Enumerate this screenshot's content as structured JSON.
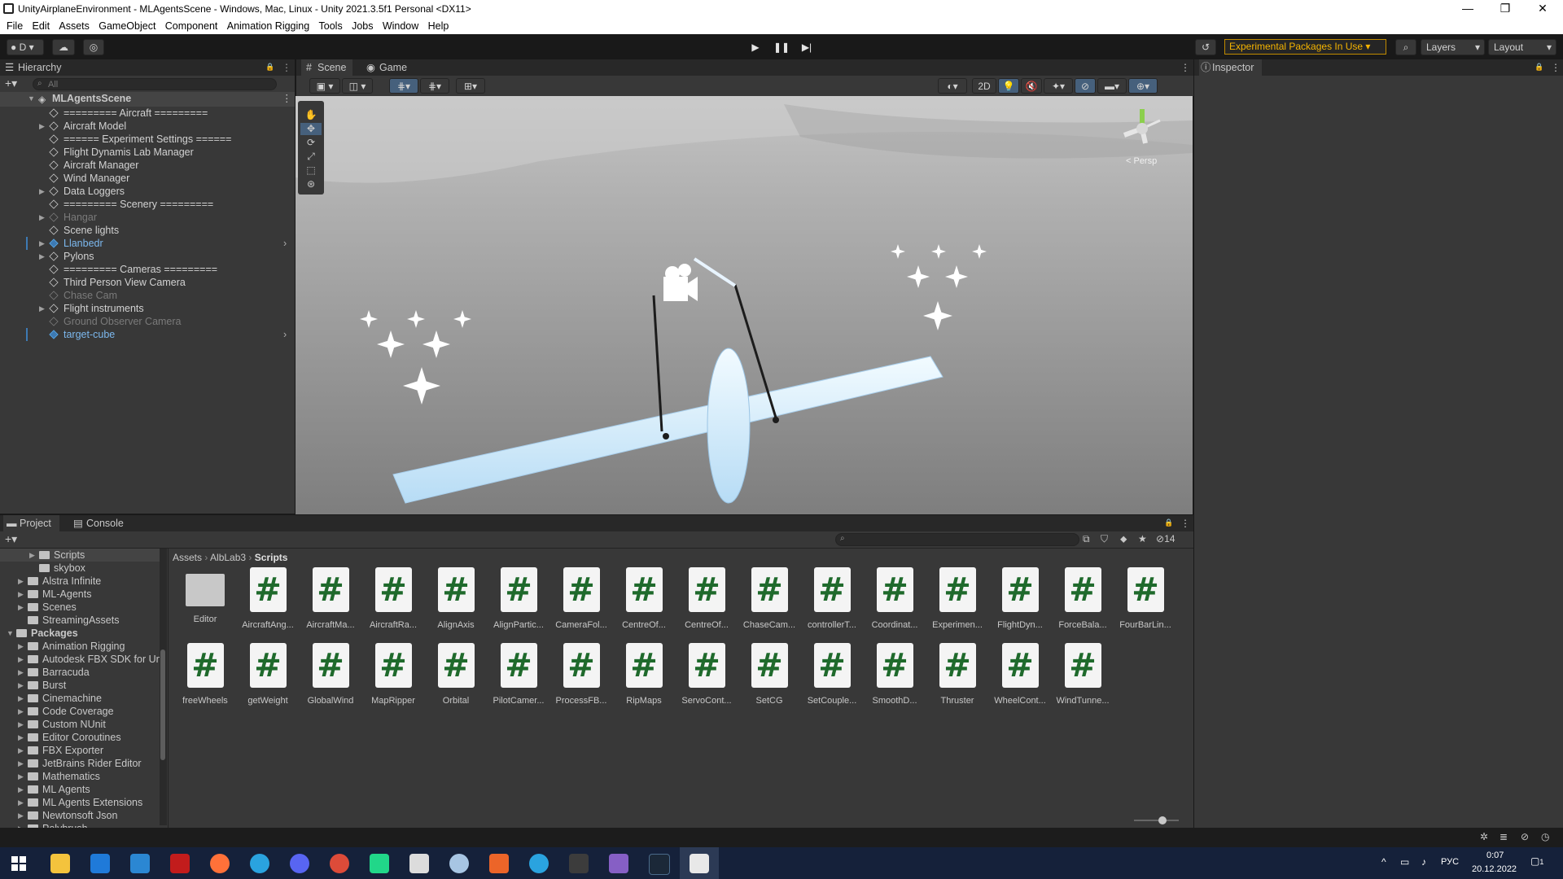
{
  "window": {
    "title": "UnityAirplaneEnvironment - MLAgentsScene - Windows, Mac, Linux - Unity 2021.3.5f1 Personal <DX11>"
  },
  "menu": [
    "File",
    "Edit",
    "Assets",
    "GameObject",
    "Component",
    "Animation Rigging",
    "Tools",
    "Jobs",
    "Window",
    "Help"
  ],
  "toolbar": {
    "account": "D",
    "experimental": "Experimental Packages In Use",
    "layers": "Layers",
    "layout": "Layout"
  },
  "hierarchy": {
    "tab": "Hierarchy",
    "search_placeholder": "All",
    "scene": "MLAgentsScene",
    "items": [
      {
        "label": "========= Aircraft =========",
        "style": "normal",
        "expand": false
      },
      {
        "label": "Aircraft Model",
        "style": "normal",
        "expand": true
      },
      {
        "label": "====== Experiment Settings ======",
        "style": "normal",
        "expand": false
      },
      {
        "label": "Flight Dynamis Lab Manager",
        "style": "normal",
        "expand": false
      },
      {
        "label": "Aircraft Manager",
        "style": "normal",
        "expand": false
      },
      {
        "label": "Wind Manager",
        "style": "normal",
        "expand": false
      },
      {
        "label": "Data Loggers",
        "style": "normal",
        "expand": true
      },
      {
        "label": "========= Scenery =========",
        "style": "normal",
        "expand": false
      },
      {
        "label": "Hangar",
        "style": "dim",
        "expand": true
      },
      {
        "label": "Scene lights",
        "style": "normal",
        "expand": false
      },
      {
        "label": "Llanbedr",
        "style": "blue",
        "expand": true
      },
      {
        "label": "Pylons",
        "style": "normal",
        "expand": true
      },
      {
        "label": "========= Cameras =========",
        "style": "normal",
        "expand": false
      },
      {
        "label": "Third Person View Camera",
        "style": "normal",
        "expand": false
      },
      {
        "label": "Chase Cam",
        "style": "dim",
        "expand": false
      },
      {
        "label": "Flight instruments",
        "style": "normal",
        "expand": true
      },
      {
        "label": "Ground Observer Camera",
        "style": "dim",
        "expand": false
      },
      {
        "label": "target-cube",
        "style": "blue",
        "expand": false
      }
    ]
  },
  "scene": {
    "tabs": [
      "Scene",
      "Game"
    ],
    "mode_2d": "2D",
    "persp": "< Persp"
  },
  "inspector": {
    "tab": "Inspector"
  },
  "project": {
    "tabs": [
      "Project",
      "Console"
    ],
    "breadcrumb": [
      "Assets",
      "AlbLab3",
      "Scripts"
    ],
    "hidden_count": "14",
    "tree": [
      {
        "label": "Scripts",
        "indent": 2,
        "expand": true
      },
      {
        "label": "skybox",
        "indent": 2,
        "expand": false
      },
      {
        "label": "Alstra Infinite",
        "indent": 1,
        "expand": true
      },
      {
        "label": "ML-Agents",
        "indent": 1,
        "expand": true
      },
      {
        "label": "Scenes",
        "indent": 1,
        "expand": true
      },
      {
        "label": "StreamingAssets",
        "indent": 1,
        "expand": false
      },
      {
        "label": "Packages",
        "indent": 0,
        "expand": true,
        "bold": true
      },
      {
        "label": "Animation Rigging",
        "indent": 1,
        "expand": true
      },
      {
        "label": "Autodesk FBX SDK for Un",
        "indent": 1,
        "expand": true
      },
      {
        "label": "Barracuda",
        "indent": 1,
        "expand": true
      },
      {
        "label": "Burst",
        "indent": 1,
        "expand": true
      },
      {
        "label": "Cinemachine",
        "indent": 1,
        "expand": true
      },
      {
        "label": "Code Coverage",
        "indent": 1,
        "expand": true
      },
      {
        "label": "Custom NUnit",
        "indent": 1,
        "expand": true
      },
      {
        "label": "Editor Coroutines",
        "indent": 1,
        "expand": true
      },
      {
        "label": "FBX Exporter",
        "indent": 1,
        "expand": true
      },
      {
        "label": "JetBrains Rider Editor",
        "indent": 1,
        "expand": true
      },
      {
        "label": "Mathematics",
        "indent": 1,
        "expand": true
      },
      {
        "label": "ML Agents",
        "indent": 1,
        "expand": true
      },
      {
        "label": "ML Agents Extensions",
        "indent": 1,
        "expand": true
      },
      {
        "label": "Newtonsoft Json",
        "indent": 1,
        "expand": true
      },
      {
        "label": "Polybrush",
        "indent": 1,
        "expand": true
      }
    ],
    "assets_row1": [
      "Editor",
      "AircraftAng...",
      "AircraftMa...",
      "AircraftRa...",
      "AlignAxis",
      "AlignPartic...",
      "CameraFol...",
      "CentreOf...",
      "CentreOf...",
      "ChaseCam...",
      "controllerT...",
      "Coordinat...",
      "Experimen...",
      "FlightDyn...",
      "ForceBala...",
      "FourBarLin..."
    ],
    "assets_row2": [
      "freeWheels",
      "getWeight",
      "GlobalWind",
      "MapRipper",
      "Orbital",
      "PilotCamer...",
      "ProcessFB...",
      "RipMaps",
      "ServoCont...",
      "SetCG",
      "SetCouple...",
      "SmoothD...",
      "Thruster",
      "WheelCont...",
      "WindTunne..."
    ]
  },
  "taskbar": {
    "lang": "РУС",
    "time": "0:07",
    "date": "20.12.2022",
    "notif": "1"
  },
  "colors": {
    "accent_blue": "#3d7ab3",
    "warning_orange": "#c08a00",
    "script_green": "#1f6a2c"
  }
}
